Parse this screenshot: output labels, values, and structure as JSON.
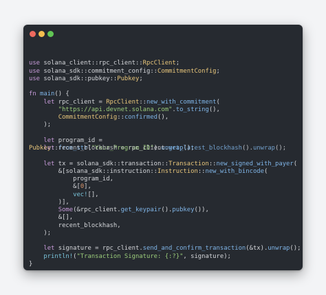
{
  "window": {
    "traffic_lights": {
      "close_color": "#ed6a5e",
      "minimize_color": "#f5bf4f",
      "maximize_color": "#61c554"
    }
  },
  "code": {
    "lines": [
      "",
      "use solana_client::rpc_client::RpcClient;",
      "use solana_sdk::commitment_config::CommitmentConfig;",
      "use solana_sdk::pubkey::Pubkey;",
      "",
      "fn main() {",
      "    let rpc_client = RpcClient::new_with_commitment(",
      "        \"https://api.devnet.solana.com\".to_string(),",
      "        CommitmentConfig::confirmed(),",
      "    );",
      "",
      "    let program_id =",
      "",
      "",
      "    let tx = solana_sdk::transaction::Transaction::new_signed_with_payer(",
      "        &[solana_sdk::instruction::Instruction::new_with_bincode(",
      "            program_id,",
      "            &[0],",
      "            vec![],",
      "        )],",
      "        Some(&rpc_client.get_keypair().pubkey()),",
      "        &[],",
      "        recent_blockhash,",
      "    );",
      "",
      "    let signature = rpc_client.send_and_confirm_transaction(&tx).unwrap();",
      "    println!(\"Transaction Signature: {:?}\", signature);",
      "}"
    ],
    "overlap_line_a": "Pubkey::from_str(\"Your_Program_ID\").unwrap();",
    "overlap_line_b": "    let recent_blockhash = rpc_client.get_latest_blockhash().unwrap();"
  },
  "colors": {
    "window_background": "#262a30",
    "page_background": "#f3f4f6",
    "keyword": "#c79bd9",
    "type": "#e7c57a",
    "function": "#7fb4e6",
    "string": "#9acb7a",
    "number": "#d8956b",
    "macro": "#79c2d8",
    "plain": "#d4d6da"
  }
}
